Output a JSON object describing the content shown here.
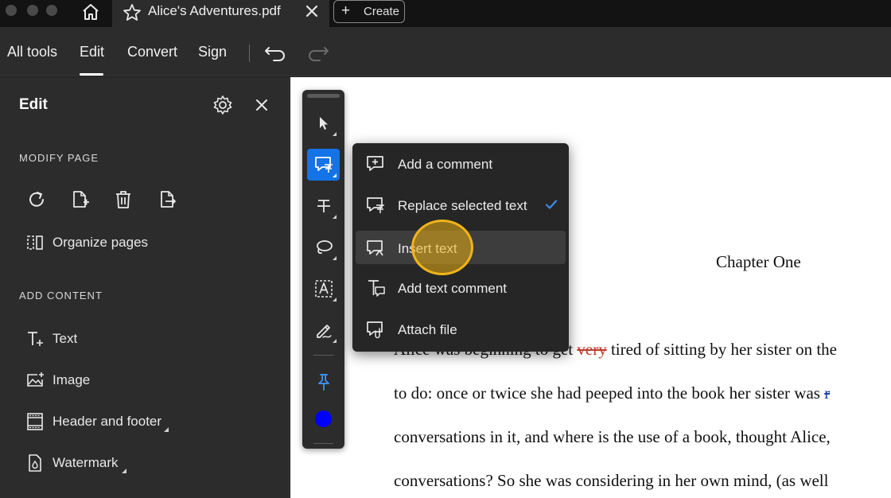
{
  "titlebar": {
    "tab_title": "Alice's Adventures.pdf",
    "create_label": "Create"
  },
  "menubar": {
    "items": [
      "All tools",
      "Edit",
      "Convert",
      "Sign"
    ],
    "active": "Edit"
  },
  "panel": {
    "title": "Edit",
    "modify_heading": "MODIFY PAGE",
    "organize_label": "Organize pages",
    "add_heading": "ADD CONTENT",
    "items": [
      "Text",
      "Image",
      "Header and footer",
      "Watermark"
    ]
  },
  "popup": {
    "items": [
      "Add a comment",
      "Replace selected text",
      "Insert text",
      "Add text comment",
      "Attach file"
    ],
    "checked": "Replace selected text",
    "hovered": "Insert text"
  },
  "palette": {
    "color": "#0000ff",
    "active_tool": "text-edit-tool"
  },
  "document": {
    "chapter": "Chapter One",
    "lines": [
      {
        "before": "Alice was beginning to get ",
        "struck": "very",
        "after": " tired of sitting by her sister on the"
      },
      {
        "before": "to do: once or twice she had peeped into the book her sister was ",
        "struck": "r",
        "after": ""
      },
      {
        "before": "conversations in it, and where is the use of a book, thought Alice,",
        "struck": "",
        "after": ""
      },
      {
        "before": "conversations? So she was considering in her own mind, (as well",
        "struck": "",
        "after": ""
      }
    ]
  },
  "colors": {
    "accent": "#1473e6",
    "highlight": "#f0b41a"
  }
}
